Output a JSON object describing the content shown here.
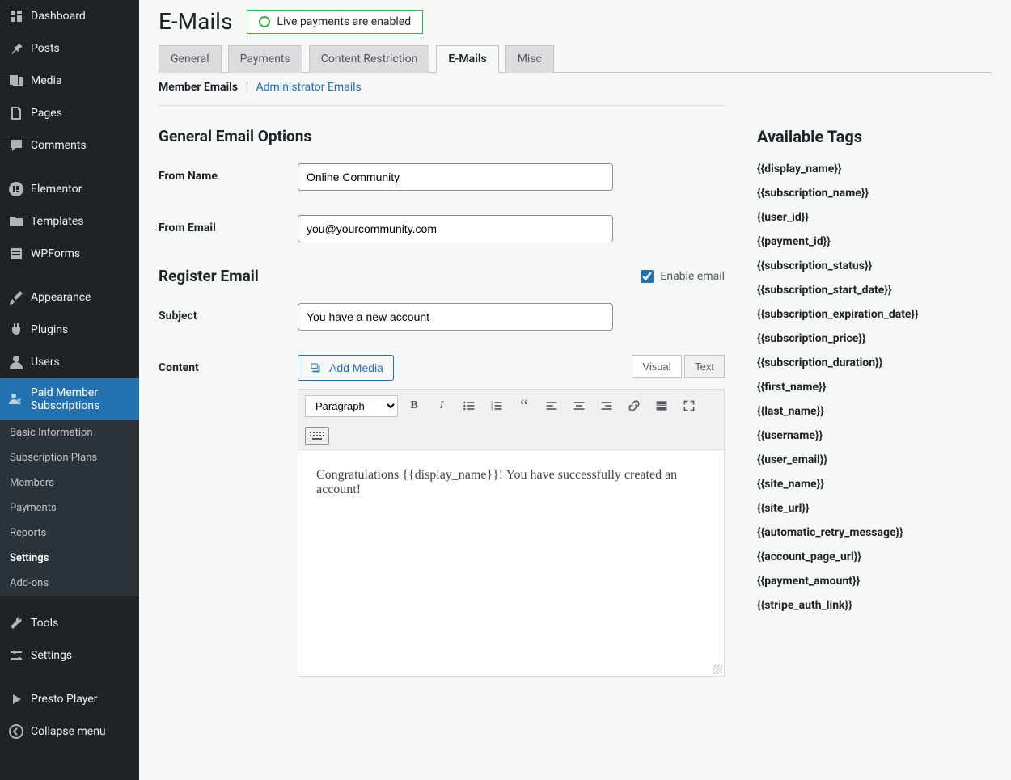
{
  "sidebar": {
    "items": [
      {
        "label": "Dashboard",
        "icon": "dashboard"
      },
      {
        "label": "Posts",
        "icon": "pin"
      },
      {
        "label": "Media",
        "icon": "media"
      },
      {
        "label": "Pages",
        "icon": "pages"
      },
      {
        "label": "Comments",
        "icon": "comment"
      },
      {
        "label": "Elementor",
        "icon": "elementor"
      },
      {
        "label": "Templates",
        "icon": "folder"
      },
      {
        "label": "WPForms",
        "icon": "forms"
      },
      {
        "label": "Appearance",
        "icon": "brush"
      },
      {
        "label": "Plugins",
        "icon": "plug"
      },
      {
        "label": "Users",
        "icon": "user"
      },
      {
        "label": "Paid Member Subscriptions",
        "icon": "pms"
      },
      {
        "label": "Tools",
        "icon": "wrench"
      },
      {
        "label": "Settings",
        "icon": "sliders"
      },
      {
        "label": "Presto Player",
        "icon": "presto"
      },
      {
        "label": "Collapse menu",
        "icon": "collapse"
      }
    ],
    "submenu": [
      "Basic Information",
      "Subscription Plans",
      "Members",
      "Payments",
      "Reports",
      "Settings",
      "Add-ons"
    ],
    "active_index": 11,
    "submenu_active_index": 5
  },
  "header": {
    "title": "E-Mails",
    "status": "Live payments are enabled"
  },
  "tabs": [
    "General",
    "Payments",
    "Content Restriction",
    "E-Mails",
    "Misc"
  ],
  "active_tab_index": 3,
  "subnav": {
    "current": "Member Emails",
    "other": "Administrator Emails"
  },
  "general_section": {
    "title": "General Email Options",
    "from_name_label": "From Name",
    "from_name_value": "Online Community",
    "from_email_label": "From Email",
    "from_email_value": "you@yourcommunity.com"
  },
  "register_section": {
    "title": "Register Email",
    "enable_label": "Enable email",
    "enable_checked": true,
    "subject_label": "Subject",
    "subject_value": "You have a new account",
    "content_label": "Content",
    "add_media_label": "Add Media",
    "visual_label": "Visual",
    "text_label": "Text",
    "paragraph_option": "Paragraph",
    "body": "Congratulations {{display_name}}! You have successfully created an account!"
  },
  "tags_section": {
    "title": "Available Tags",
    "tags": [
      "{{display_name}}",
      "{{subscription_name}}",
      "{{user_id}}",
      "{{payment_id}}",
      "{{subscription_status}}",
      "{{subscription_start_date}}",
      "{{subscription_expiration_date}}",
      "{{subscription_price}}",
      "{{subscription_duration}}",
      "{{first_name}}",
      "{{last_name}}",
      "{{username}}",
      "{{user_email}}",
      "{{site_name}}",
      "{{site_url}}",
      "{{automatic_retry_message}}",
      "{{account_page_url}}",
      "{{payment_amount}}",
      "{{stripe_auth_link}}"
    ]
  }
}
